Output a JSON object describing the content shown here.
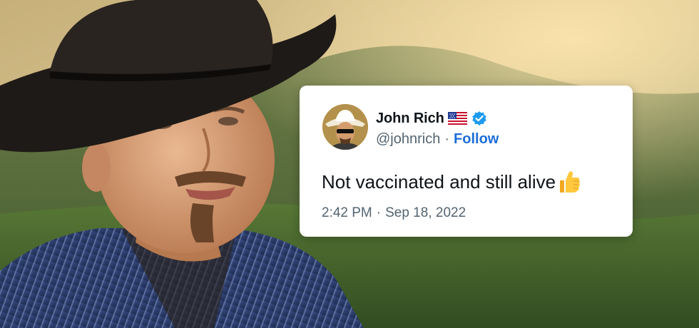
{
  "tweet": {
    "display_name": "John Rich",
    "handle": "@johnrich",
    "separator": "·",
    "follow_label": "Follow",
    "text": "Not vaccinated and still alive",
    "time": "2:42 PM",
    "date": "Sep 18, 2022",
    "icons": [
      "us-flag-icon",
      "verified-badge-icon",
      "thumbs-up-icon"
    ],
    "colors": {
      "follow": "#1d6ed8",
      "verified": "#1d9bf0",
      "handle": "#536471"
    }
  }
}
